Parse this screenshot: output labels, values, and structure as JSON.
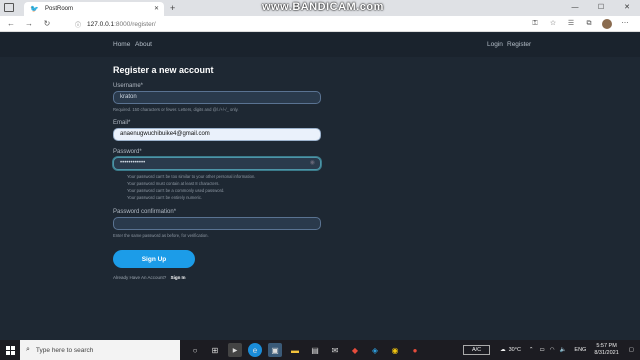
{
  "browser": {
    "tab_title": "PostRoom",
    "tab_close": "✕",
    "new_tab": "+",
    "url_host": "127.0.0.1",
    "url_path": ":8000/register/",
    "win_min": "—",
    "win_max": "☐",
    "win_close": "✕"
  },
  "watermark": "www.BANDICAM.com",
  "nav": {
    "home": "Home",
    "about": "About",
    "login": "Login",
    "register": "Register"
  },
  "form": {
    "title": "Register a new account",
    "username_label": "Username*",
    "username_value": "kraton",
    "username_help": "Required. 150 characters or fewer. Letters, digits and @/./+/-/_ only.",
    "email_label": "Email*",
    "email_value": "anaenugwuchibuike4@gmail.com",
    "password_label": "Password*",
    "password_value": "••••••••••••",
    "password_help": [
      "Your password can't be too similar to your other personal information.",
      "Your password must contain at least 8 characters.",
      "Your password can't be a commonly used password.",
      "Your password can't be entirely numeric."
    ],
    "confirm_label": "Password confirmation*",
    "confirm_value": "",
    "confirm_help": "Enter the same password as before, for verification.",
    "submit_label": "Sign Up",
    "have_account": "Already Have An Account?",
    "signin_link": "Sign In"
  },
  "taskbar": {
    "search_placeholder": "Type here to search",
    "ac_label": "A/C",
    "weather": "30°C",
    "lang": "ENG",
    "time": "5:57 PM",
    "date": "8/31/2021"
  },
  "colors": {
    "page_bg": "#1e2833",
    "accent": "#1c9ce8"
  }
}
